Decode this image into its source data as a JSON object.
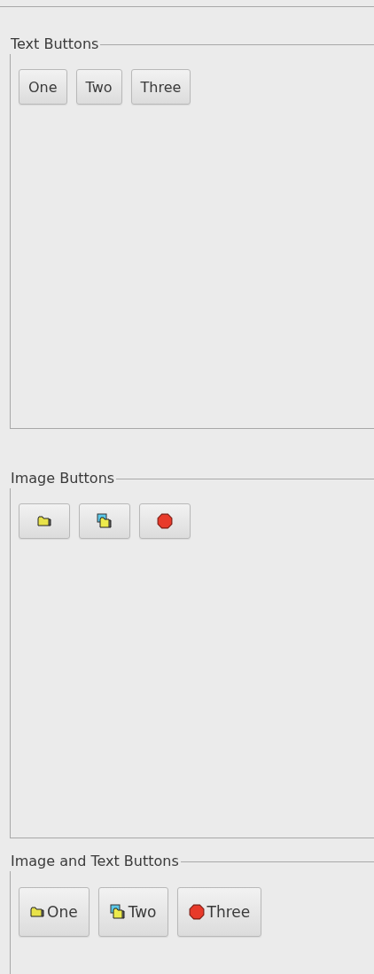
{
  "groups": [
    {
      "title": "Text Buttons",
      "kind": "text",
      "buttons": [
        {
          "label": "One"
        },
        {
          "label": "Two"
        },
        {
          "label": "Three"
        }
      ]
    },
    {
      "title": "Image Buttons",
      "kind": "image",
      "buttons": [
        {
          "kind": "icon"
        },
        {
          "kind": "icon"
        },
        {
          "kind": "icon"
        }
      ]
    },
    {
      "title": "Image and Text Buttons",
      "kind": "image_text",
      "buttons": [
        {
          "label": "One"
        },
        {
          "label": "Two"
        },
        {
          "label": "Three"
        }
      ]
    }
  ]
}
